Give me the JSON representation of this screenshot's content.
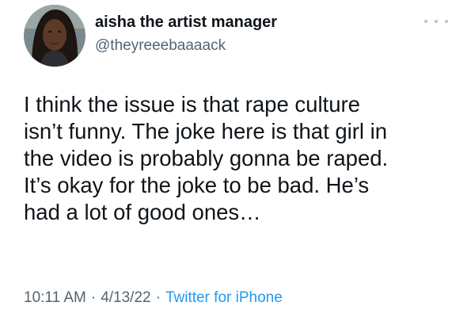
{
  "author": {
    "display_name": "aisha the artist manager",
    "handle": "@theyreeebaaaack"
  },
  "tweet": {
    "lines": [
      "I think the issue is that rape culture",
      "isn’t funny. The joke here is that girl in",
      "the video is probably gonna be raped.",
      "It’s okay for the joke to be bad. He’s",
      "had a lot of good ones…"
    ],
    "time": "10:11 AM",
    "date": "4/13/22",
    "source": "Twitter for iPhone",
    "separator": "·"
  },
  "icons": {
    "more": "more-dots-icon",
    "avatar": "profile-photo"
  },
  "colors": {
    "text": "#0f1419",
    "secondary": "#536471",
    "link": "#1d9bf0"
  }
}
